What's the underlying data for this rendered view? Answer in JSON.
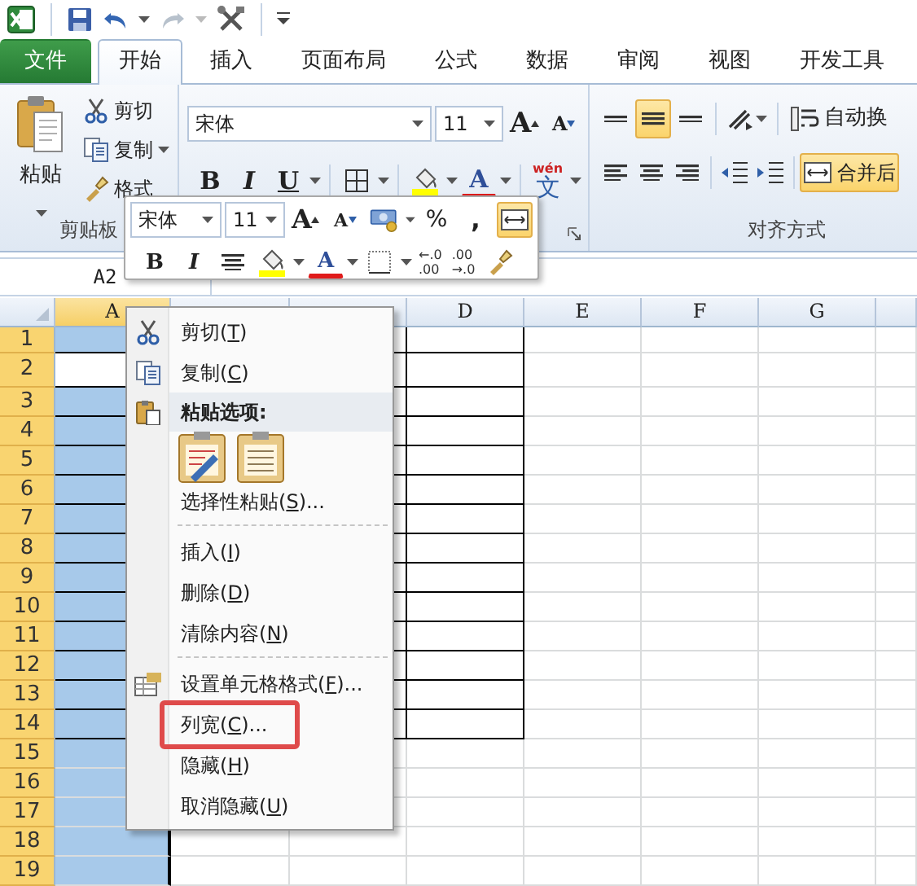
{
  "quick_access": {
    "redo": {
      "disabled": true
    }
  },
  "tabs": [
    {
      "label": "文件",
      "kind": "file",
      "selected": false
    },
    {
      "label": "开始",
      "kind": "tab",
      "selected": true
    },
    {
      "label": "插入",
      "kind": "tab",
      "selected": false
    },
    {
      "label": "页面布局",
      "kind": "tab",
      "selected": false
    },
    {
      "label": "公式",
      "kind": "tab",
      "selected": false
    },
    {
      "label": "数据",
      "kind": "tab",
      "selected": false
    },
    {
      "label": "审阅",
      "kind": "tab",
      "selected": false
    },
    {
      "label": "视图",
      "kind": "tab",
      "selected": false
    },
    {
      "label": "开发工具",
      "kind": "tab",
      "selected": false
    }
  ],
  "clipboard": {
    "paste": "粘贴",
    "cut": "剪切",
    "copy": "复制",
    "format_painter": "格式",
    "group_label": "剪贴板"
  },
  "font": {
    "font_name": "宋体",
    "font_size": "11",
    "grow_glyph": "A",
    "shrink_glyph": "A",
    "bold_glyph": "B",
    "italic_glyph": "I",
    "underline_glyph": "U",
    "font_color_glyph": "A",
    "phonetic_pinyin": "wén",
    "phonetic_glyph": "文"
  },
  "alignment": {
    "vertical": [
      {
        "selected": false
      },
      {
        "selected": true
      },
      {
        "selected": false
      }
    ],
    "wrap_text": "自动换",
    "merge_center": {
      "label": "合并后",
      "selected": true
    },
    "group_label": "对齐方式"
  },
  "mini_toolbar": {
    "font_name": "宋体",
    "font_size": "11",
    "grow_glyph": "A",
    "shrink_glyph": "A",
    "percent": "%",
    "comma": ",",
    "merge_selected": true,
    "bold_glyph": "B",
    "italic_glyph": "I",
    "font_color_glyph": "A",
    "increase_decimal": {
      "top": "←.0",
      "bottom": ".00"
    },
    "decrease_decimal": {
      "top": ".00",
      "bottom": "→.0"
    }
  },
  "name_box": "A2",
  "sheet": {
    "columns": [
      {
        "label": "A",
        "selected": true
      },
      {
        "selected": false
      },
      {
        "selected": false
      },
      {
        "label": "D",
        "selected": false
      },
      {
        "label": "E",
        "selected": false
      },
      {
        "label": "F",
        "selected": false
      },
      {
        "label": "G",
        "selected": false
      },
      {
        "selected": false
      }
    ],
    "rows": [
      {
        "label": "1",
        "selected": true,
        "active_cell": false,
        "bordered": true
      },
      {
        "label": "2",
        "selected": true,
        "active_cell": true,
        "bordered": true
      },
      {
        "label": "3",
        "selected": true,
        "active_cell": false,
        "bordered": true
      },
      {
        "label": "4",
        "selected": true,
        "active_cell": false,
        "bordered": true
      },
      {
        "label": "5",
        "selected": true,
        "active_cell": false,
        "bordered": true
      },
      {
        "label": "6",
        "selected": true,
        "active_cell": false,
        "bordered": true
      },
      {
        "label": "7",
        "selected": true,
        "active_cell": false,
        "bordered": true
      },
      {
        "label": "8",
        "selected": true,
        "active_cell": false,
        "bordered": true
      },
      {
        "label": "9",
        "selected": true,
        "active_cell": false,
        "bordered": true
      },
      {
        "label": "10",
        "selected": true,
        "active_cell": false,
        "bordered": true
      },
      {
        "label": "11",
        "selected": true,
        "active_cell": false,
        "bordered": true
      },
      {
        "label": "12",
        "selected": true,
        "active_cell": false,
        "bordered": true
      },
      {
        "label": "13",
        "selected": true,
        "active_cell": false,
        "bordered": true
      },
      {
        "label": "14",
        "selected": true,
        "active_cell": false,
        "bordered": true
      },
      {
        "label": "15",
        "selected": true,
        "active_cell": false,
        "bordered": false
      },
      {
        "label": "16",
        "selected": true,
        "active_cell": false,
        "bordered": false
      },
      {
        "label": "17",
        "selected": true,
        "active_cell": false,
        "bordered": false
      },
      {
        "label": "18",
        "selected": true,
        "active_cell": false,
        "bordered": false
      },
      {
        "label": "19",
        "selected": true,
        "active_cell": false,
        "bordered": false
      }
    ]
  },
  "context_menu": [
    {
      "kind": "item",
      "label": "剪切(",
      "key": "T",
      "tail": ")",
      "highlight": false
    },
    {
      "kind": "item",
      "label": "复制(",
      "key": "C",
      "tail": ")",
      "highlight": false
    },
    {
      "kind": "header",
      "label": "粘贴选项:"
    },
    {
      "kind": "paste_options"
    },
    {
      "kind": "item",
      "label": "选择性粘贴(",
      "key": "S",
      "tail": ")...",
      "highlight": false
    },
    {
      "kind": "separator"
    },
    {
      "kind": "item",
      "label": "插入(",
      "key": "I",
      "tail": ")",
      "highlight": false
    },
    {
      "kind": "item",
      "label": "删除(",
      "key": "D",
      "tail": ")",
      "highlight": false
    },
    {
      "kind": "item",
      "label": "清除内容(",
      "key": "N",
      "tail": ")",
      "highlight": false
    },
    {
      "kind": "separator"
    },
    {
      "kind": "item",
      "label": "设置单元格格式(",
      "key": "F",
      "tail": ")...",
      "highlight": false
    },
    {
      "kind": "item",
      "label": "列宽(",
      "key": "C",
      "tail": ")...",
      "highlight": true
    },
    {
      "kind": "item",
      "label": "隐藏(",
      "key": "H",
      "tail": ")",
      "highlight": false
    },
    {
      "kind": "item",
      "label": "取消隐藏(",
      "key": "U",
      "tail": ")",
      "highlight": false
    }
  ]
}
